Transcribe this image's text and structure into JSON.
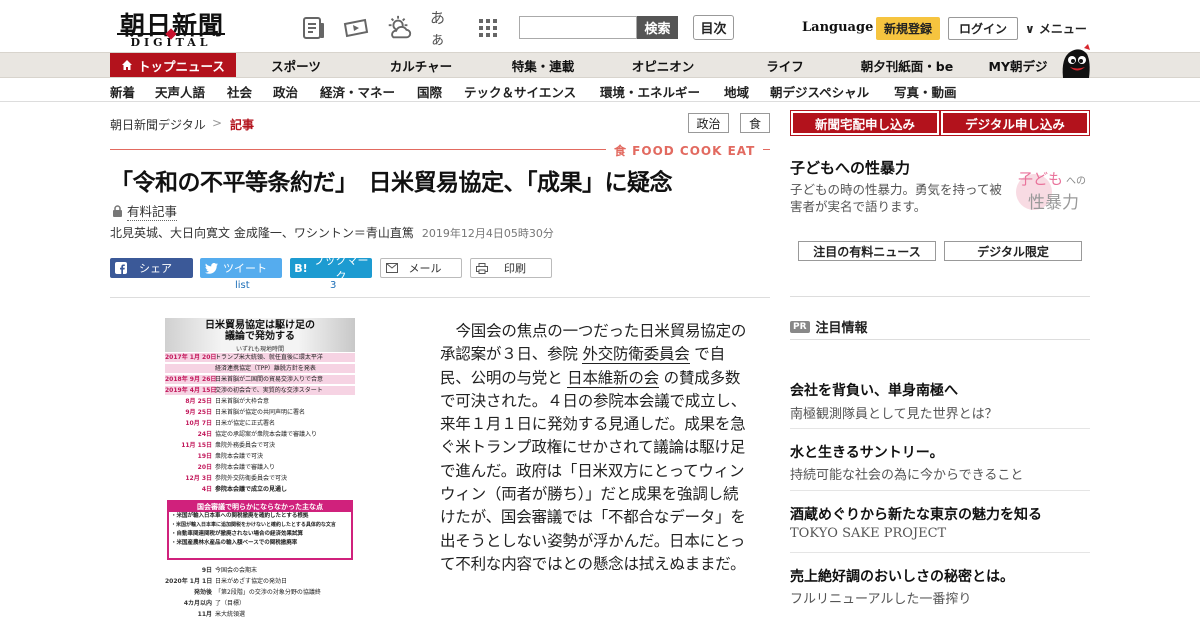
{
  "header": {
    "logo_main": "朝日新聞",
    "logo_sub": "DIGITAL",
    "furigana_label": "あぁ",
    "search_button": "検索",
    "toc_button": "目次",
    "language_link": "Language",
    "register_button": "新規登録",
    "login_button": "ログイン",
    "menu_link": "∨ メニュー"
  },
  "main_nav": [
    {
      "label": "トップニュース"
    },
    {
      "label": "スポーツ"
    },
    {
      "label": "カルチャー"
    },
    {
      "label": "特集・連載"
    },
    {
      "label": "オピニオン"
    },
    {
      "label": "ライフ"
    },
    {
      "label": "朝夕刊紙面・be"
    },
    {
      "label": "MY朝デジ"
    }
  ],
  "sub_nav": [
    {
      "label": "新着"
    },
    {
      "label": "天声人語"
    },
    {
      "label": "社会"
    },
    {
      "label": "政治"
    },
    {
      "label": "経済・マネー"
    },
    {
      "label": "国際"
    },
    {
      "label": "テック＆サイエンス"
    },
    {
      "label": "環境・エネルギー"
    },
    {
      "label": "地域"
    },
    {
      "label": "朝デジスペシャル"
    },
    {
      "label": "写真・動画"
    }
  ],
  "breadcrumb": {
    "home": "朝日新聞デジタル",
    "separator": ">",
    "current": "記事"
  },
  "tags": [
    "政治",
    "食"
  ],
  "food_badge": "食 FOOD COOK EAT",
  "article": {
    "headline": "「令和の不平等条約だ」　日米貿易協定、「成果」に疑念",
    "paid_label": "有料記事",
    "authors": "北見英城、大日向寛文 金成隆一、ワシントン＝青山直篤",
    "date": "2019年12月4日05時30分",
    "body_1": "今国会の焦点の一つだった日米貿易協定の承認案が３日、参院 ",
    "link_1": "外交防衛委員会",
    "body_2": " で自民、公明の与党と ",
    "link_2": "日本維新の会",
    "body_3": " の賛成多数で可決された。４日の参院本会議で成立し、来年１月１日に発効する見通しだ。成果を急ぐ米トランプ政権にせかされて議論は駆け足で進んだ。政府は「日米双方にとってウィンウィン（両者が勝ち）」だと成果を強調し続けたが、国会審議では「不都合なデータ」を出そうとしない姿勢が浮かんだ。日本にとって不利な内容ではとの懸念は拭えぬままだ。"
  },
  "share": {
    "facebook": "シェア",
    "twitter": "ツイート",
    "twitter_count": "list",
    "hatena": "ブックマーク",
    "hatena_icon": "B!",
    "hatena_count": "3",
    "mail": "メール",
    "print": "印刷"
  },
  "graphic": {
    "title_1": "日米貿易協定は駆け足の",
    "title_2": "議論で発効する",
    "subtitle": "いずれも現地時間",
    "rows": [
      {
        "date": "2017年 1月 20日",
        "text": "トランプ米大統領、就任直後に環太平洋",
        "pink": true
      },
      {
        "date": "",
        "text": "経済連携協定（TPP）離脱方針を発表",
        "pink": true
      },
      {
        "date": "2018年 9月 26日",
        "text": "日米首脳が二国間の貿易交渉入りで合意",
        "pink": true
      },
      {
        "date": "2019年 4月 15日",
        "text": "交渉の初会合で、実質的な交渉スタート",
        "pink": true
      },
      {
        "date": "8月 25日",
        "text": "日米首脳が大枠合意",
        "pink": false
      },
      {
        "date": "9月 25日",
        "text": "日米首脳が協定の共同声明に署名",
        "pink": false
      },
      {
        "date": "10月 7日",
        "text": "日米が協定に正式署名",
        "pink": false
      },
      {
        "date": "24日",
        "text": "協定の承認案が衆院本会議で審議入り",
        "pink": false
      },
      {
        "date": "11月 15日",
        "text": "衆院外務委員会で可決",
        "pink": false
      },
      {
        "date": "19日",
        "text": "衆院本会議で可決",
        "pink": false
      },
      {
        "date": "20日",
        "text": "参院本会議で審議入り",
        "pink": false
      },
      {
        "date": "12月 3日",
        "text": "参院外交防衛委員会で可決",
        "pink": false
      },
      {
        "date": "4日",
        "text": "参院本会議で成立の見通し",
        "pink": false
      }
    ],
    "box_title": "国会審議で明らかにならなかった主な点",
    "box_lines": [
      "・米国が輸入日本車への関税撤廃を確約したとする根拠",
      "・米国が輸入日本車に追加関税をかけないと確約したとする具体的な文言",
      "・自動車関連関税が撤廃されない場合の経済効果試算",
      "・米国産農林水産品の輸入額ベースでの関税撤廃率"
    ],
    "rows_after": [
      {
        "date": "9日",
        "text": "今国会の会期末"
      },
      {
        "date": "2020年 1月 1日",
        "text": "日米がめざす協定の発効日"
      },
      {
        "date": "発効後",
        "text": "「第2段階」の交渉の対象分野の協議終"
      },
      {
        "date": "4カ月以内",
        "text": "了（目標）"
      },
      {
        "date": "11月",
        "text": "米大統領選"
      }
    ]
  },
  "right": {
    "subscribe_paper": "新聞宅配申し込み",
    "subscribe_digital": "デジタル申し込み",
    "promo_title": "子どもへの性暴力",
    "promo_text": "子どもの時の性暴力。勇気を持って被害者が実名で語ります。",
    "promo_art_1": "子ども",
    "promo_art_2": "への",
    "promo_art_3": "性暴力",
    "tab_paid": "注目の有料ニュース",
    "tab_digital": "デジタル限定",
    "pr_badge": "PR",
    "pr_heading": "注目情報",
    "pr_items": [
      {
        "title": "会社を背負い、単身南極へ",
        "desc": "南極観測隊員として見た世界とは？"
      },
      {
        "title": "水と生きるサントリー。",
        "desc": "持続可能な社会の為に今からできること"
      },
      {
        "title": "酒蔵めぐりから新たな東京の魅力を知る",
        "desc": "TOKYO SAKE PROJECT"
      },
      {
        "title": "売上絶好調のおいしさの秘密とは。",
        "desc": "フルリニューアルした一番搾り"
      }
    ]
  },
  "colors": {
    "brand_red": "#b3121c",
    "register_yellow": "#f6c43f",
    "facebook": "#3b5998",
    "twitter": "#55acee",
    "hatena": "#1d9bd1"
  }
}
